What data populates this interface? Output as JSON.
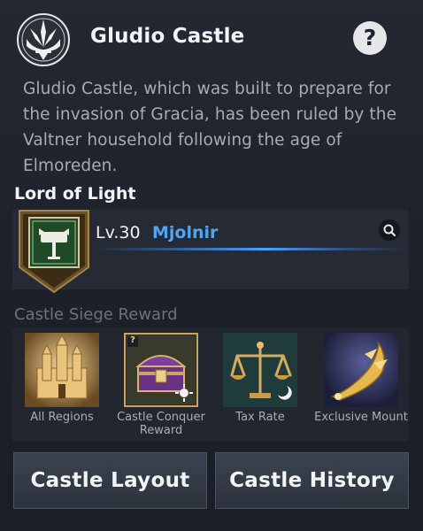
{
  "header": {
    "title": "Gludio Castle",
    "help_label": "?",
    "description": "Gludio Castle, which was built to prepare for the invasion of Gracia, has been ruled by the Valtner household following the age of Elmoreden."
  },
  "lord": {
    "heading": "Lord of Light",
    "level": "Lv.30",
    "name": "Mjolnir"
  },
  "rewards": {
    "heading": "Castle Siege Reward",
    "items": [
      {
        "label": "All Regions"
      },
      {
        "label": "Castle Conquer Reward",
        "badge": "?"
      },
      {
        "label": "Tax Rate"
      },
      {
        "label": "Exclusive Mount"
      }
    ]
  },
  "buttons": {
    "layout": "Castle Layout",
    "history": "Castle History"
  },
  "colors": {
    "background": "#1d222b",
    "accent_blue": "#4ea7f0",
    "gold": "#c9a45a"
  }
}
